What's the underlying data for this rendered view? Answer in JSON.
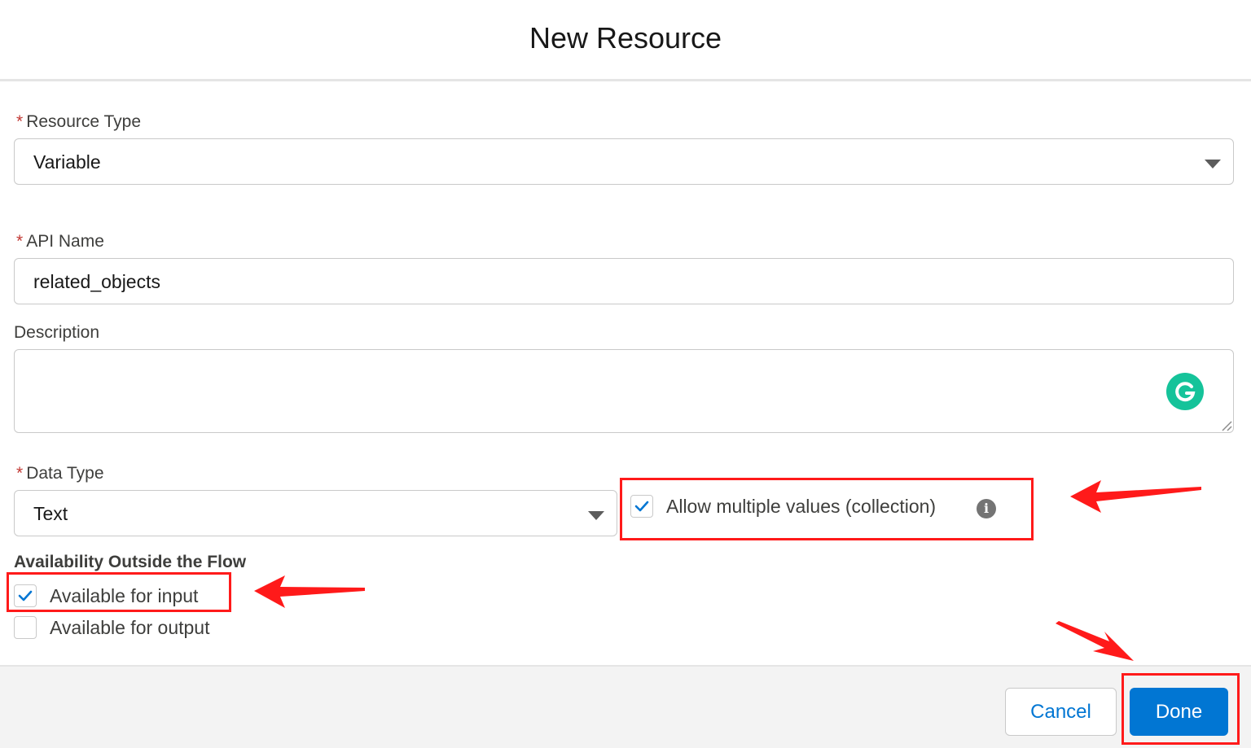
{
  "modal": {
    "title": "New Resource"
  },
  "resource_type": {
    "label": "Resource Type",
    "value": "Variable"
  },
  "api_name": {
    "label": "API Name",
    "value": "related_objects"
  },
  "description": {
    "label": "Description",
    "value": ""
  },
  "data_type": {
    "label": "Data Type",
    "value": "Text"
  },
  "allow_multiple": {
    "label": "Allow multiple values (collection)",
    "checked": true
  },
  "availability": {
    "title": "Availability Outside the Flow",
    "input": {
      "label": "Available for input",
      "checked": true
    },
    "output": {
      "label": "Available for output",
      "checked": false
    }
  },
  "required_marker": "*",
  "info_glyph": "i",
  "footer": {
    "cancel_label": "Cancel",
    "done_label": "Done"
  },
  "colors": {
    "brand": "#0176d3",
    "required": "#c23934",
    "annotation": "#ff1a1a",
    "grammarly": "#15c39a"
  }
}
